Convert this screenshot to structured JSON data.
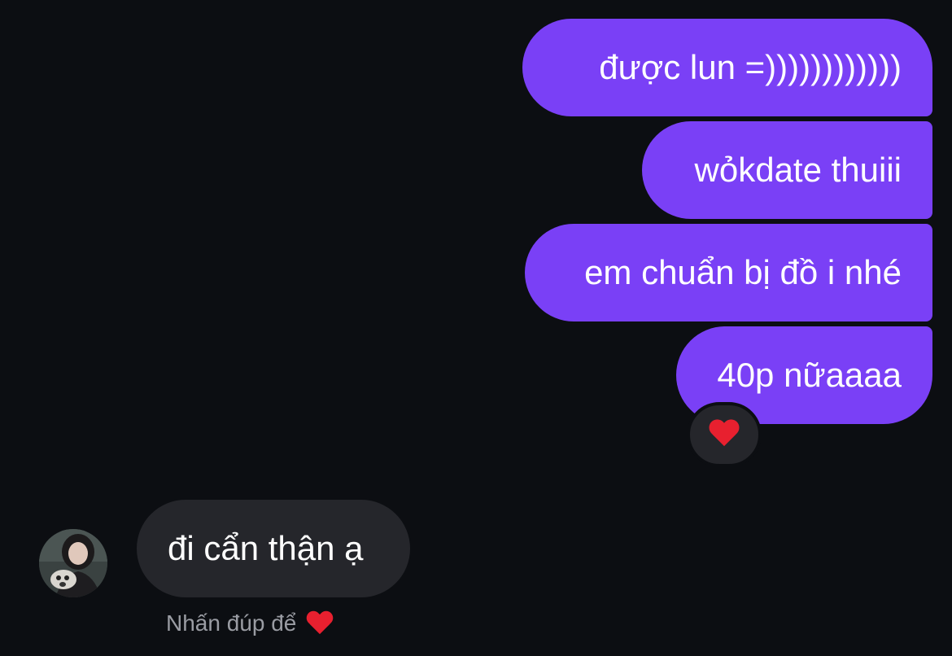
{
  "colors": {
    "background": "#0c0e12",
    "outgoing_bubble": "#7a40f6",
    "incoming_bubble": "#25262b",
    "hint_text": "#9a9ca3",
    "reaction_heart": "#e8202f"
  },
  "outgoing_messages": [
    {
      "text": "được lun =))))))))))))"
    },
    {
      "text": "wỏkdate thuiii"
    },
    {
      "text": "em chuẩn bị đồ i nhé"
    },
    {
      "text": "40p nữaaaa",
      "reaction": "heart-icon"
    }
  ],
  "incoming_messages": [
    {
      "text": "đi cẩn thận ạ",
      "avatar": "user-avatar"
    }
  ],
  "hint": {
    "text": "Nhấn đúp để",
    "icon": "heart-icon"
  }
}
